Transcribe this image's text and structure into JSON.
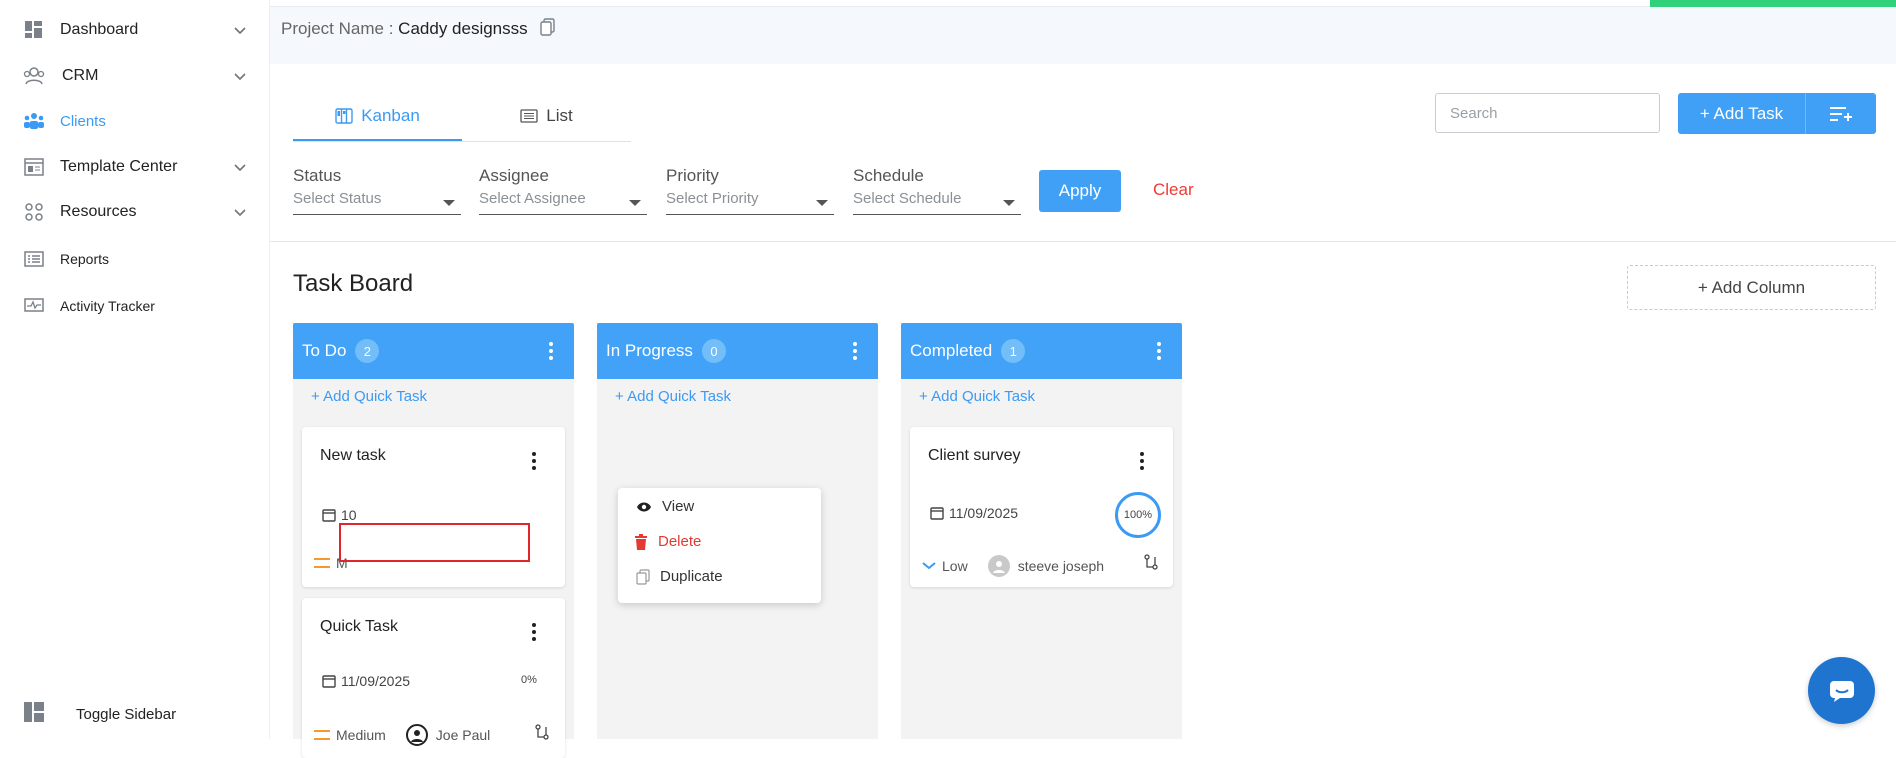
{
  "sidebar": {
    "items": [
      {
        "label": "Dashboard",
        "icon": "dashboard-icon",
        "expandable": true
      },
      {
        "label": "CRM",
        "icon": "crm-icon",
        "expandable": true
      },
      {
        "label": "Clients",
        "icon": "clients-icon",
        "expandable": false,
        "active": true
      },
      {
        "label": "Template Center",
        "icon": "template-icon",
        "expandable": true
      },
      {
        "label": "Resources",
        "icon": "resources-icon",
        "expandable": true
      },
      {
        "label": "Reports",
        "icon": "reports-icon",
        "expandable": false
      },
      {
        "label": "Activity Tracker",
        "icon": "activity-icon",
        "expandable": false
      }
    ],
    "toggle_label": "Toggle Sidebar"
  },
  "project": {
    "label": "Project Name :",
    "name": "Caddy designsss"
  },
  "tabs": [
    {
      "label": "Kanban",
      "active": true
    },
    {
      "label": "List",
      "active": false
    }
  ],
  "search": {
    "placeholder": "Search",
    "value": ""
  },
  "toolbar": {
    "add_task_label": "+ Add Task"
  },
  "filters": [
    {
      "label": "Status",
      "placeholder": "Select Status"
    },
    {
      "label": "Assignee",
      "placeholder": "Select Assignee"
    },
    {
      "label": "Priority",
      "placeholder": "Select Priority"
    },
    {
      "label": "Schedule",
      "placeholder": "Select Schedule"
    }
  ],
  "filter_actions": {
    "apply_label": "Apply",
    "clear_label": "Clear"
  },
  "board": {
    "title": "Task Board",
    "add_column_label": "+ Add Column",
    "quick_add_label": "+ Add Quick Task",
    "columns": [
      {
        "name": "To Do",
        "count": "2"
      },
      {
        "name": "In Progress",
        "count": "0"
      },
      {
        "name": "Completed",
        "count": "1"
      }
    ]
  },
  "cards": {
    "todo_1": {
      "title": "New task",
      "date": "10",
      "priority": "M"
    },
    "todo_2": {
      "title": "Quick Task",
      "date": "11/09/2025",
      "progress": "0%",
      "priority": "Medium",
      "assignee": "Joe Paul"
    },
    "completed_1": {
      "title": "Client survey",
      "date": "11/09/2025",
      "progress": "100%",
      "priority": "Low",
      "assignee": "steeve joseph"
    }
  },
  "context_menu": {
    "view_label": "View",
    "delete_label": "Delete",
    "duplicate_label": "Duplicate"
  },
  "colors": {
    "accent": "#3fa0f6",
    "danger": "#e33a33",
    "success": "#2fd17a",
    "priority_medium": "#f39a2a"
  }
}
